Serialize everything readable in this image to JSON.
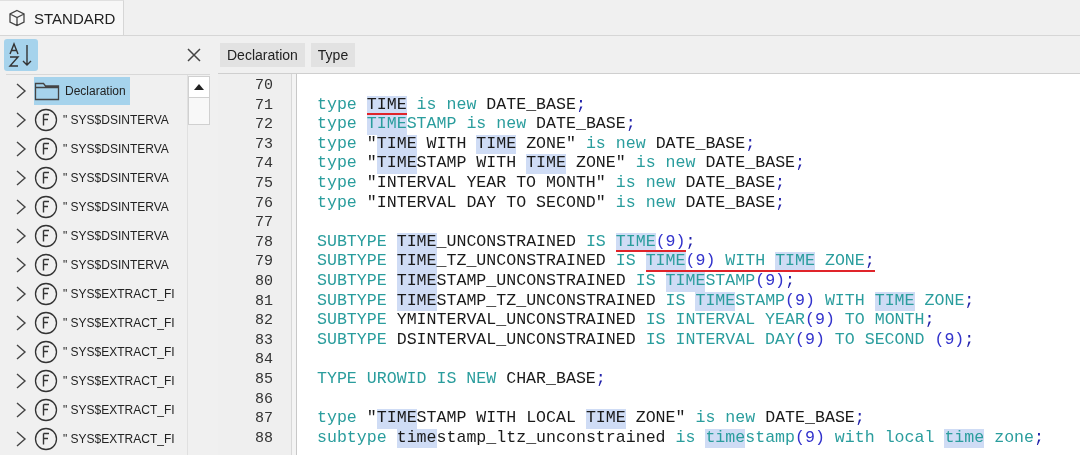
{
  "tab": {
    "label": "STANDARD",
    "selected": true
  },
  "sidebar": {
    "items": [
      {
        "kind": "folder",
        "label": "Declaration",
        "selected": true
      },
      {
        "kind": "function",
        "label": "\" SYS$DSINTERVA",
        "selected": false
      },
      {
        "kind": "function",
        "label": "\" SYS$DSINTERVA",
        "selected": false
      },
      {
        "kind": "function",
        "label": "\" SYS$DSINTERVA",
        "selected": false
      },
      {
        "kind": "function",
        "label": "\" SYS$DSINTERVA",
        "selected": false
      },
      {
        "kind": "function",
        "label": "\" SYS$DSINTERVA",
        "selected": false
      },
      {
        "kind": "function",
        "label": "\" SYS$DSINTERVA",
        "selected": false
      },
      {
        "kind": "function",
        "label": "\" SYS$EXTRACT_FI",
        "selected": false
      },
      {
        "kind": "function",
        "label": "\" SYS$EXTRACT_FI",
        "selected": false
      },
      {
        "kind": "function",
        "label": "\" SYS$EXTRACT_FI",
        "selected": false
      },
      {
        "kind": "function",
        "label": "\" SYS$EXTRACT_FI",
        "selected": false
      },
      {
        "kind": "function",
        "label": "\" SYS$EXTRACT_FI",
        "selected": false
      },
      {
        "kind": "function",
        "label": "\" SYS$EXTRACT_FI",
        "selected": false
      }
    ]
  },
  "editor_toolbar": {
    "buttons": [
      "Declaration",
      "Type"
    ]
  },
  "editor": {
    "lines": [
      {
        "number": "70"
      },
      {
        "number": "71",
        "tokens": [
          {
            "text": "type ",
            "kind": "keyword",
            "highlight": false,
            "underline": false
          },
          {
            "text": "TIME",
            "kind": "name",
            "highlight": true,
            "underline": true
          },
          {
            "text": " is new ",
            "kind": "keyword",
            "highlight": false,
            "underline": false
          },
          {
            "text": "DATE_BASE",
            "kind": "name",
            "highlight": false,
            "underline": false
          },
          {
            "text": ";",
            "kind": "symbol",
            "highlight": false,
            "underline": false
          }
        ]
      },
      {
        "number": "72",
        "tokens": [
          {
            "text": "type ",
            "kind": "keyword",
            "highlight": false,
            "underline": false
          },
          {
            "text": "TIME",
            "kind": "keyword",
            "highlight": true,
            "underline": false
          },
          {
            "text": "STAMP is new ",
            "kind": "keyword",
            "highlight": false,
            "underline": false
          },
          {
            "text": "DATE_BASE",
            "kind": "name",
            "highlight": false,
            "underline": false
          },
          {
            "text": ";",
            "kind": "symbol",
            "highlight": false,
            "underline": false
          }
        ]
      },
      {
        "number": "73",
        "tokens": [
          {
            "text": "type ",
            "kind": "keyword",
            "highlight": false,
            "underline": false
          },
          {
            "text": "\"",
            "kind": "name",
            "highlight": false,
            "underline": false
          },
          {
            "text": "TIME",
            "kind": "name",
            "highlight": true,
            "underline": false
          },
          {
            "text": " WITH ",
            "kind": "name",
            "highlight": false,
            "underline": false
          },
          {
            "text": "TIME",
            "kind": "name",
            "highlight": true,
            "underline": false
          },
          {
            "text": " ZONE\"",
            "kind": "name",
            "highlight": false,
            "underline": false
          },
          {
            "text": " is new ",
            "kind": "keyword",
            "highlight": false,
            "underline": false
          },
          {
            "text": "DATE_BASE",
            "kind": "name",
            "highlight": false,
            "underline": false
          },
          {
            "text": ";",
            "kind": "symbol",
            "highlight": false,
            "underline": false
          }
        ]
      },
      {
        "number": "74",
        "tokens": [
          {
            "text": "type ",
            "kind": "keyword",
            "highlight": false,
            "underline": false
          },
          {
            "text": "\"",
            "kind": "name",
            "highlight": false,
            "underline": false
          },
          {
            "text": "TIME",
            "kind": "name",
            "highlight": true,
            "underline": false
          },
          {
            "text": "STAMP WITH ",
            "kind": "name",
            "highlight": false,
            "underline": false
          },
          {
            "text": "TIME",
            "kind": "name",
            "highlight": true,
            "underline": false
          },
          {
            "text": " ZONE\"",
            "kind": "name",
            "highlight": false,
            "underline": false
          },
          {
            "text": " is new ",
            "kind": "keyword",
            "highlight": false,
            "underline": false
          },
          {
            "text": "DATE_BASE",
            "kind": "name",
            "highlight": false,
            "underline": false
          },
          {
            "text": ";",
            "kind": "symbol",
            "highlight": false,
            "underline": false
          }
        ]
      },
      {
        "number": "75",
        "tokens": [
          {
            "text": "type ",
            "kind": "keyword",
            "highlight": false,
            "underline": false
          },
          {
            "text": "\"INTERVAL YEAR TO MONTH\"",
            "kind": "name",
            "highlight": false,
            "underline": false
          },
          {
            "text": " is new ",
            "kind": "keyword",
            "highlight": false,
            "underline": false
          },
          {
            "text": "DATE_BASE",
            "kind": "name",
            "highlight": false,
            "underline": false
          },
          {
            "text": ";",
            "kind": "symbol",
            "highlight": false,
            "underline": false
          }
        ]
      },
      {
        "number": "76",
        "tokens": [
          {
            "text": "type ",
            "kind": "keyword",
            "highlight": false,
            "underline": false
          },
          {
            "text": "\"INTERVAL DAY TO SECOND\"",
            "kind": "name",
            "highlight": false,
            "underline": false
          },
          {
            "text": " is new ",
            "kind": "keyword",
            "highlight": false,
            "underline": false
          },
          {
            "text": "DATE_BASE",
            "kind": "name",
            "highlight": false,
            "underline": false
          },
          {
            "text": ";",
            "kind": "symbol",
            "highlight": false,
            "underline": false
          }
        ]
      },
      {
        "number": "77"
      },
      {
        "number": "78",
        "tokens": [
          {
            "text": "SUBTYPE ",
            "kind": "keyword",
            "highlight": false,
            "underline": false
          },
          {
            "text": "TIME",
            "kind": "name",
            "highlight": true,
            "underline": false
          },
          {
            "text": "_UNCONSTRAINED",
            "kind": "name",
            "highlight": false,
            "underline": false
          },
          {
            "text": " IS ",
            "kind": "keyword",
            "highlight": false,
            "underline": false
          },
          {
            "text": "TIME",
            "kind": "keyword",
            "highlight": true,
            "underline": true
          },
          {
            "text": "(9)",
            "kind": "number",
            "highlight": false,
            "underline": true
          },
          {
            "text": ";",
            "kind": "symbol",
            "highlight": false,
            "underline": false
          }
        ]
      },
      {
        "number": "79",
        "tokens": [
          {
            "text": "SUBTYPE ",
            "kind": "keyword",
            "highlight": false,
            "underline": false
          },
          {
            "text": "TIME",
            "kind": "name",
            "highlight": true,
            "underline": false
          },
          {
            "text": "_TZ_UNCONSTRAINED",
            "kind": "name",
            "highlight": false,
            "underline": false
          },
          {
            "text": " IS ",
            "kind": "keyword",
            "highlight": false,
            "underline": false
          },
          {
            "text": "TIME",
            "kind": "keyword",
            "highlight": true,
            "underline": true
          },
          {
            "text": "(9)",
            "kind": "number",
            "highlight": false,
            "underline": true
          },
          {
            "text": " WITH ",
            "kind": "keyword",
            "highlight": false,
            "underline": true
          },
          {
            "text": "TIME",
            "kind": "keyword",
            "highlight": true,
            "underline": true
          },
          {
            "text": " ZONE",
            "kind": "keyword",
            "highlight": false,
            "underline": true
          },
          {
            "text": ";",
            "kind": "symbol",
            "highlight": false,
            "underline": true
          }
        ]
      },
      {
        "number": "80",
        "tokens": [
          {
            "text": "SUBTYPE ",
            "kind": "keyword",
            "highlight": false,
            "underline": false
          },
          {
            "text": "TIME",
            "kind": "name",
            "highlight": true,
            "underline": false
          },
          {
            "text": "STAMP_UNCONSTRAINED",
            "kind": "name",
            "highlight": false,
            "underline": false
          },
          {
            "text": " IS ",
            "kind": "keyword",
            "highlight": false,
            "underline": false
          },
          {
            "text": "TIME",
            "kind": "keyword",
            "highlight": true,
            "underline": false
          },
          {
            "text": "STAMP",
            "kind": "keyword",
            "highlight": false,
            "underline": false
          },
          {
            "text": "(9)",
            "kind": "number",
            "highlight": false,
            "underline": false
          },
          {
            "text": ";",
            "kind": "symbol",
            "highlight": false,
            "underline": false
          }
        ]
      },
      {
        "number": "81",
        "tokens": [
          {
            "text": "SUBTYPE ",
            "kind": "keyword",
            "highlight": false,
            "underline": false
          },
          {
            "text": "TIME",
            "kind": "name",
            "highlight": true,
            "underline": false
          },
          {
            "text": "STAMP_TZ_UNCONSTRAINED",
            "kind": "name",
            "highlight": false,
            "underline": false
          },
          {
            "text": " IS ",
            "kind": "keyword",
            "highlight": false,
            "underline": false
          },
          {
            "text": "TIME",
            "kind": "keyword",
            "highlight": true,
            "underline": false
          },
          {
            "text": "STAMP",
            "kind": "keyword",
            "highlight": false,
            "underline": false
          },
          {
            "text": "(9)",
            "kind": "number",
            "highlight": false,
            "underline": false
          },
          {
            "text": " WITH ",
            "kind": "keyword",
            "highlight": false,
            "underline": false
          },
          {
            "text": "TIME",
            "kind": "keyword",
            "highlight": true,
            "underline": false
          },
          {
            "text": " ZONE",
            "kind": "keyword",
            "highlight": false,
            "underline": false
          },
          {
            "text": ";",
            "kind": "symbol",
            "highlight": false,
            "underline": false
          }
        ]
      },
      {
        "number": "82",
        "tokens": [
          {
            "text": "SUBTYPE ",
            "kind": "keyword",
            "highlight": false,
            "underline": false
          },
          {
            "text": "YMINTERVAL_UNCONSTRAINED",
            "kind": "name",
            "highlight": false,
            "underline": false
          },
          {
            "text": " IS INTERVAL YEAR",
            "kind": "keyword",
            "highlight": false,
            "underline": false
          },
          {
            "text": "(9)",
            "kind": "number",
            "highlight": false,
            "underline": false
          },
          {
            "text": " TO MONTH",
            "kind": "keyword",
            "highlight": false,
            "underline": false
          },
          {
            "text": ";",
            "kind": "symbol",
            "highlight": false,
            "underline": false
          }
        ]
      },
      {
        "number": "83",
        "tokens": [
          {
            "text": "SUBTYPE ",
            "kind": "keyword",
            "highlight": false,
            "underline": false
          },
          {
            "text": "DSINTERVAL_UNCONSTRAINED",
            "kind": "name",
            "highlight": false,
            "underline": false
          },
          {
            "text": " IS INTERVAL DAY",
            "kind": "keyword",
            "highlight": false,
            "underline": false
          },
          {
            "text": "(9)",
            "kind": "number",
            "highlight": false,
            "underline": false
          },
          {
            "text": " TO SECOND ",
            "kind": "keyword",
            "highlight": false,
            "underline": false
          },
          {
            "text": "(9)",
            "kind": "number",
            "highlight": false,
            "underline": false
          },
          {
            "text": ";",
            "kind": "symbol",
            "highlight": false,
            "underline": false
          }
        ]
      },
      {
        "number": "84"
      },
      {
        "number": "85",
        "tokens": [
          {
            "text": "TYPE UROWID IS NEW ",
            "kind": "keyword",
            "highlight": false,
            "underline": false
          },
          {
            "text": "CHAR_BASE",
            "kind": "name",
            "highlight": false,
            "underline": false
          },
          {
            "text": ";",
            "kind": "symbol",
            "highlight": false,
            "underline": false
          }
        ]
      },
      {
        "number": "86"
      },
      {
        "number": "87",
        "tokens": [
          {
            "text": "type ",
            "kind": "keyword",
            "highlight": false,
            "underline": false
          },
          {
            "text": "\"",
            "kind": "name",
            "highlight": false,
            "underline": false
          },
          {
            "text": "TIME",
            "kind": "name",
            "highlight": true,
            "underline": false
          },
          {
            "text": "STAMP WITH LOCAL ",
            "kind": "name",
            "highlight": false,
            "underline": false
          },
          {
            "text": "TIME",
            "kind": "name",
            "highlight": true,
            "underline": false
          },
          {
            "text": " ZONE\"",
            "kind": "name",
            "highlight": false,
            "underline": false
          },
          {
            "text": " is new ",
            "kind": "keyword",
            "highlight": false,
            "underline": false
          },
          {
            "text": "DATE_BASE",
            "kind": "name",
            "highlight": false,
            "underline": false
          },
          {
            "text": ";",
            "kind": "symbol",
            "highlight": false,
            "underline": false
          }
        ]
      },
      {
        "number": "88",
        "tokens": [
          {
            "text": "subtype ",
            "kind": "keyword",
            "highlight": false,
            "underline": false
          },
          {
            "text": "time",
            "kind": "name",
            "highlight": true,
            "underline": false
          },
          {
            "text": "stamp_ltz_unconstrained",
            "kind": "name",
            "highlight": false,
            "underline": false
          },
          {
            "text": " is ",
            "kind": "keyword",
            "highlight": false,
            "underline": false
          },
          {
            "text": "time",
            "kind": "keyword",
            "highlight": true,
            "underline": false
          },
          {
            "text": "stamp",
            "kind": "keyword",
            "highlight": false,
            "underline": false
          },
          {
            "text": "(9)",
            "kind": "number",
            "highlight": false,
            "underline": false
          },
          {
            "text": " with local ",
            "kind": "keyword",
            "highlight": false,
            "underline": false
          },
          {
            "text": "time",
            "kind": "keyword",
            "highlight": true,
            "underline": false
          },
          {
            "text": " zone",
            "kind": "keyword",
            "highlight": false,
            "underline": false
          },
          {
            "text": ";",
            "kind": "symbol",
            "highlight": false,
            "underline": false
          }
        ]
      }
    ]
  }
}
